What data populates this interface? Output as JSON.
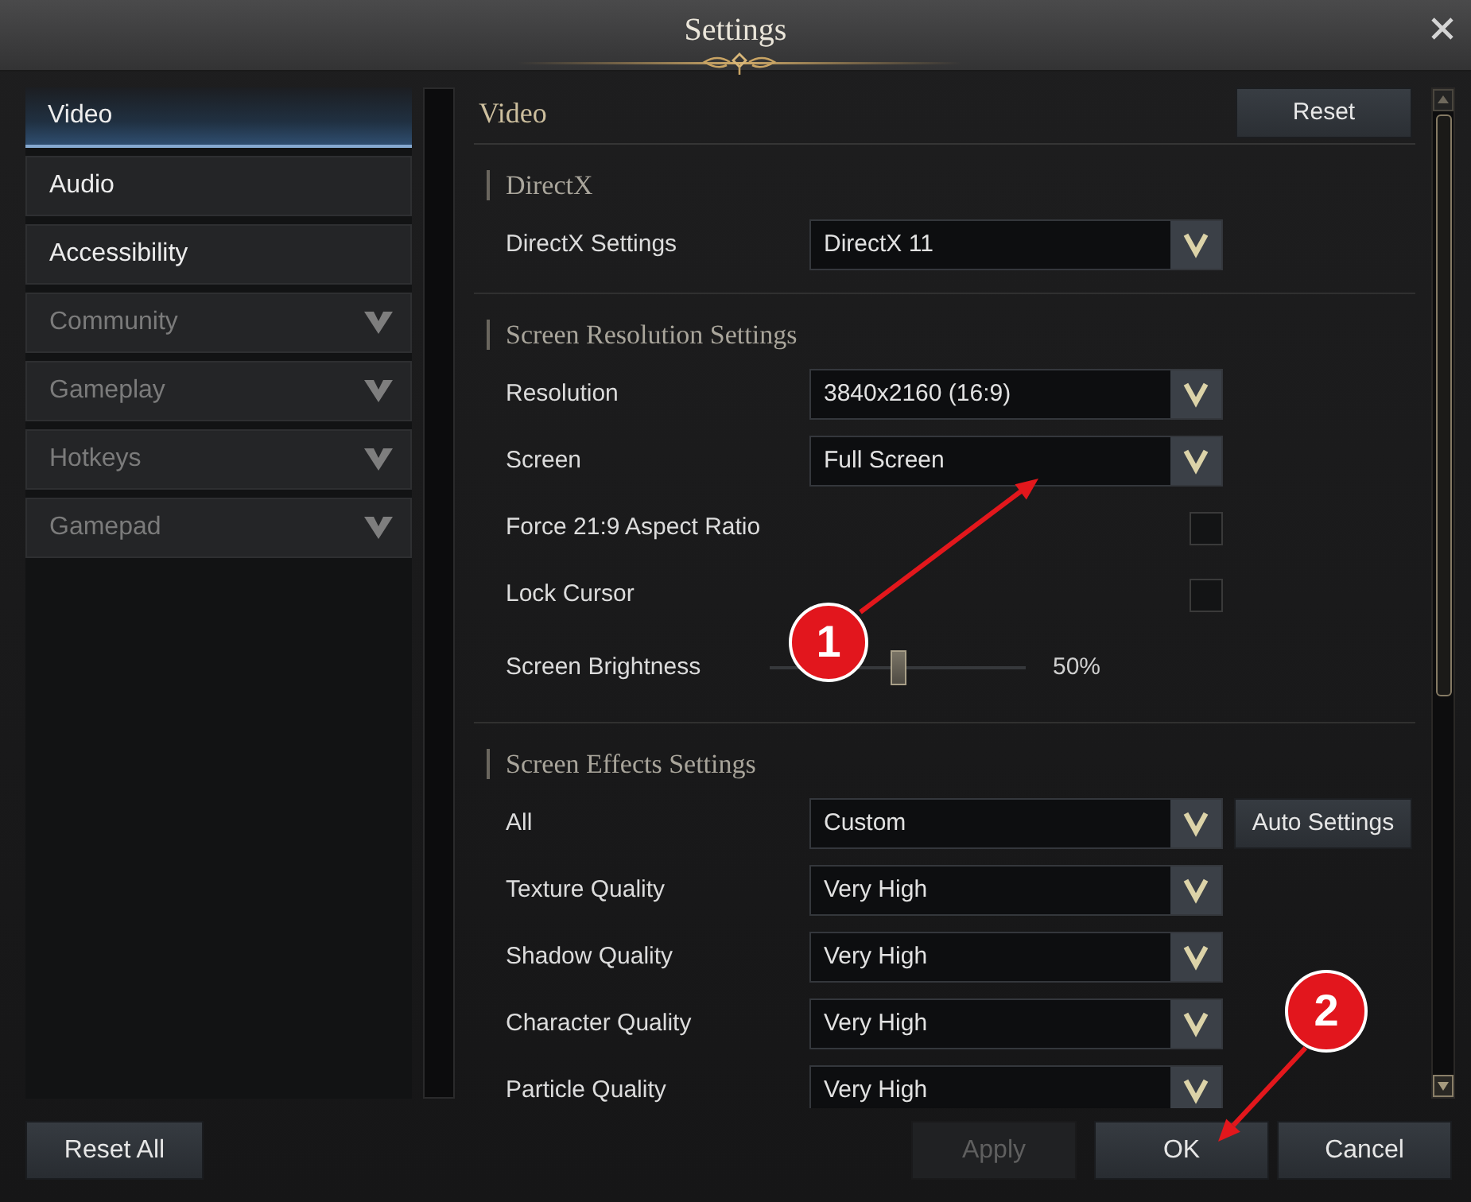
{
  "window": {
    "title": "Settings"
  },
  "sidebar": {
    "items": [
      {
        "label": "Video",
        "selected": true,
        "disabled": false,
        "expandable": false
      },
      {
        "label": "Audio",
        "selected": false,
        "disabled": false,
        "expandable": false
      },
      {
        "label": "Accessibility",
        "selected": false,
        "disabled": false,
        "expandable": false
      },
      {
        "label": "Community",
        "selected": false,
        "disabled": true,
        "expandable": true
      },
      {
        "label": "Gameplay",
        "selected": false,
        "disabled": true,
        "expandable": true
      },
      {
        "label": "Hotkeys",
        "selected": false,
        "disabled": true,
        "expandable": true
      },
      {
        "label": "Gamepad",
        "selected": false,
        "disabled": true,
        "expandable": true
      }
    ]
  },
  "panel": {
    "title": "Video",
    "reset_button": "Reset",
    "sections": [
      {
        "title": "DirectX",
        "rows": [
          {
            "kind": "dropdown",
            "label": "DirectX Settings",
            "value": "DirectX 11"
          }
        ]
      },
      {
        "title": "Screen Resolution Settings",
        "rows": [
          {
            "kind": "dropdown",
            "label": "Resolution",
            "value": "3840x2160 (16:9)"
          },
          {
            "kind": "dropdown",
            "label": "Screen",
            "value": "Full Screen"
          },
          {
            "kind": "checkbox",
            "label": "Force 21:9 Aspect Ratio",
            "checked": false
          },
          {
            "kind": "checkbox",
            "label": "Lock Cursor",
            "checked": false
          },
          {
            "kind": "slider",
            "label": "Screen Brightness",
            "level": 0.5,
            "reading": "50%"
          }
        ]
      },
      {
        "title": "Screen Effects Settings",
        "rows": [
          {
            "kind": "dropdown",
            "label": "All",
            "value": "Custom",
            "button": "Auto Settings"
          },
          {
            "kind": "dropdown",
            "label": "Texture Quality",
            "value": "Very High"
          },
          {
            "kind": "dropdown",
            "label": "Shadow Quality",
            "value": "Very High"
          },
          {
            "kind": "dropdown",
            "label": "Character Quality",
            "value": "Very High"
          },
          {
            "kind": "dropdown",
            "label": "Particle Quality",
            "value": "Very High"
          }
        ]
      }
    ]
  },
  "footer": {
    "reset_all_button": "Reset All",
    "buttons": [
      {
        "label": "Apply",
        "disabled": true
      },
      {
        "label": "OK",
        "disabled": false
      },
      {
        "label": "Cancel",
        "disabled": false
      }
    ]
  },
  "annotations": [
    {
      "label": "1"
    },
    {
      "label": "2"
    }
  ]
}
